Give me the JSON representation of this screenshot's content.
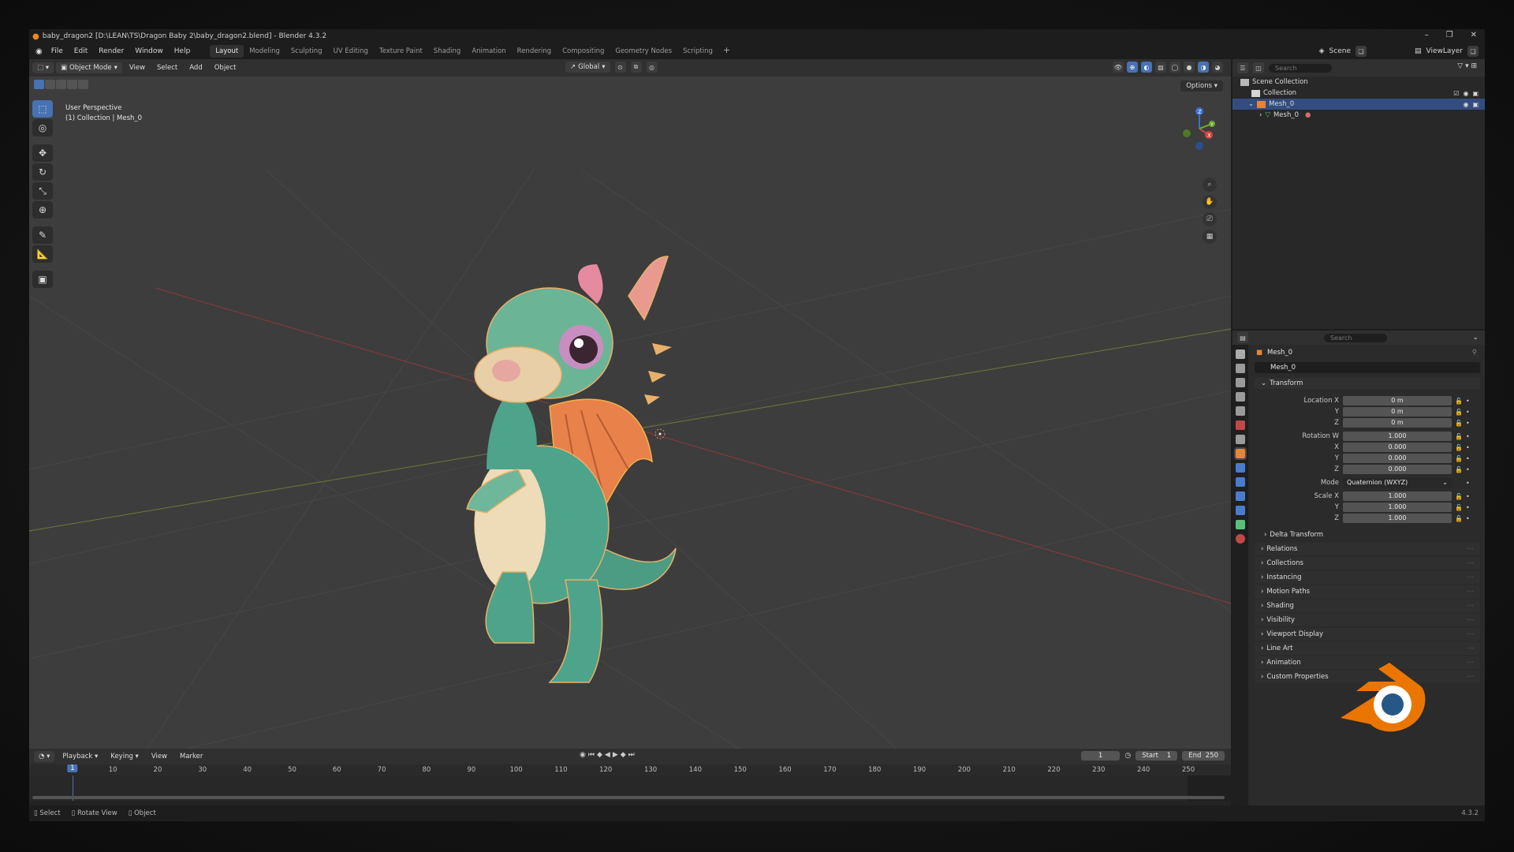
{
  "window": {
    "title": "baby_dragon2 [D:\\LEAN\\TS\\Dragon Baby 2\\baby_dragon2.blend] - Blender 4.3.2",
    "controls": [
      "–",
      "❐",
      "✕"
    ]
  },
  "menu": {
    "items": [
      "File",
      "Edit",
      "Render",
      "Window",
      "Help"
    ],
    "workspaces": [
      "Layout",
      "Modeling",
      "Sculpting",
      "UV Editing",
      "Texture Paint",
      "Shading",
      "Animation",
      "Rendering",
      "Compositing",
      "Geometry Nodes",
      "Scripting"
    ],
    "active_workspace": "Layout",
    "add": "+",
    "scene": "Scene",
    "view_layer": "ViewLayer"
  },
  "viewport": {
    "mode": "Object Mode",
    "menus": [
      "View",
      "Select",
      "Add",
      "Object"
    ],
    "orientation": "Global",
    "options": "Options",
    "info_line1": "User Perspective",
    "info_line2": "(1) Collection | Mesh_0",
    "gizmo_axes": [
      "Z",
      "X",
      "Y"
    ]
  },
  "timeline": {
    "menus": [
      "Playback",
      "Keying",
      "View",
      "Marker"
    ],
    "current_frame": "1",
    "start_label": "Start",
    "start": "1",
    "end_label": "End",
    "end": "250",
    "ticks": [
      "1",
      "10",
      "20",
      "30",
      "40",
      "50",
      "60",
      "70",
      "80",
      "90",
      "100",
      "110",
      "120",
      "130",
      "140",
      "150",
      "160",
      "170",
      "180",
      "190",
      "200",
      "210",
      "220",
      "230",
      "240",
      "250"
    ]
  },
  "statusbar": {
    "select": "Select",
    "rotate": "Rotate View",
    "object": "Object",
    "version": "4.3.2"
  },
  "outliner": {
    "search_placeholder": "Search",
    "scene_collection": "Scene Collection",
    "collection": "Collection",
    "object": "Mesh_0",
    "mesh": "Mesh_0"
  },
  "properties": {
    "search_placeholder": "Search",
    "object_name": "Mesh_0",
    "name_field": "Mesh_0",
    "transform": {
      "title": "Transform",
      "location_label": "Location X",
      "location": [
        "0 m",
        "0 m",
        "0 m"
      ],
      "rotation_label": "Rotation W",
      "rotation": [
        "1.000",
        "0.000",
        "0.000",
        "0.000"
      ],
      "mode_label": "Mode",
      "mode": "Quaternion (WXYZ)",
      "scale_label": "Scale X",
      "scale": [
        "1.000",
        "1.000",
        "1.000"
      ],
      "axis_y": "Y",
      "axis_z": "Z",
      "axis_x": "X",
      "delta": "Delta Transform"
    },
    "panels": [
      "Relations",
      "Collections",
      "Instancing",
      "Motion Paths",
      "Shading",
      "Visibility",
      "Viewport Display",
      "Line Art",
      "Animation",
      "Custom Properties"
    ]
  },
  "colors": {
    "accent": "#4772b3",
    "brand_orange": "#ea7600",
    "brand_blue": "#265787"
  }
}
